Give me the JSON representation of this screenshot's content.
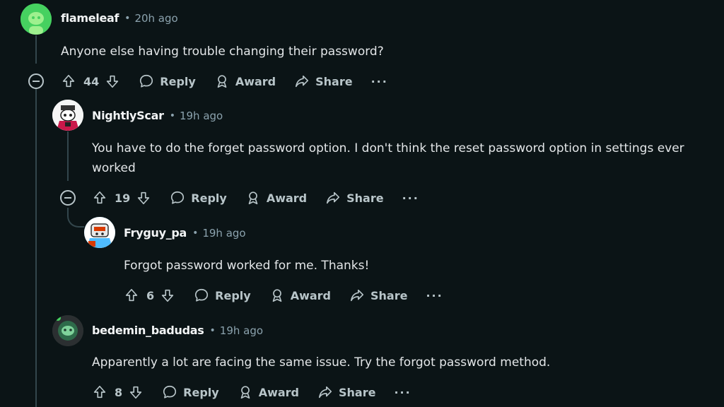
{
  "comments": [
    {
      "username": "flameleaf",
      "time": "20h ago",
      "body": "Anyone else having trouble changing their password?",
      "votes": "44",
      "avatar_color": "#46d160"
    },
    {
      "username": "NightlyScar",
      "time": "19h ago",
      "body": "You have to do the forget password option. I don't think the reset password option in settings ever worked",
      "votes": "19",
      "avatar_color": "#e0e0e0"
    },
    {
      "username": "Fryguy_pa",
      "time": "19h ago",
      "body": "Forgot password worked for me. Thanks!",
      "votes": "6",
      "avatar_color": "#4fbcff"
    },
    {
      "username": "bedemin_badudas",
      "time": "19h ago",
      "body": "Apparently a lot are facing the same issue. Try the forgot password method.",
      "votes": "8",
      "avatar_color": "#2e6b4a"
    }
  ],
  "actions": {
    "reply": "Reply",
    "award": "Award",
    "share": "Share",
    "more": "···"
  },
  "icons": [
    "upvote-icon",
    "downvote-icon",
    "reply-bubble-icon",
    "award-icon",
    "share-icon",
    "more-icon",
    "collapse-icon"
  ],
  "separator": "•"
}
